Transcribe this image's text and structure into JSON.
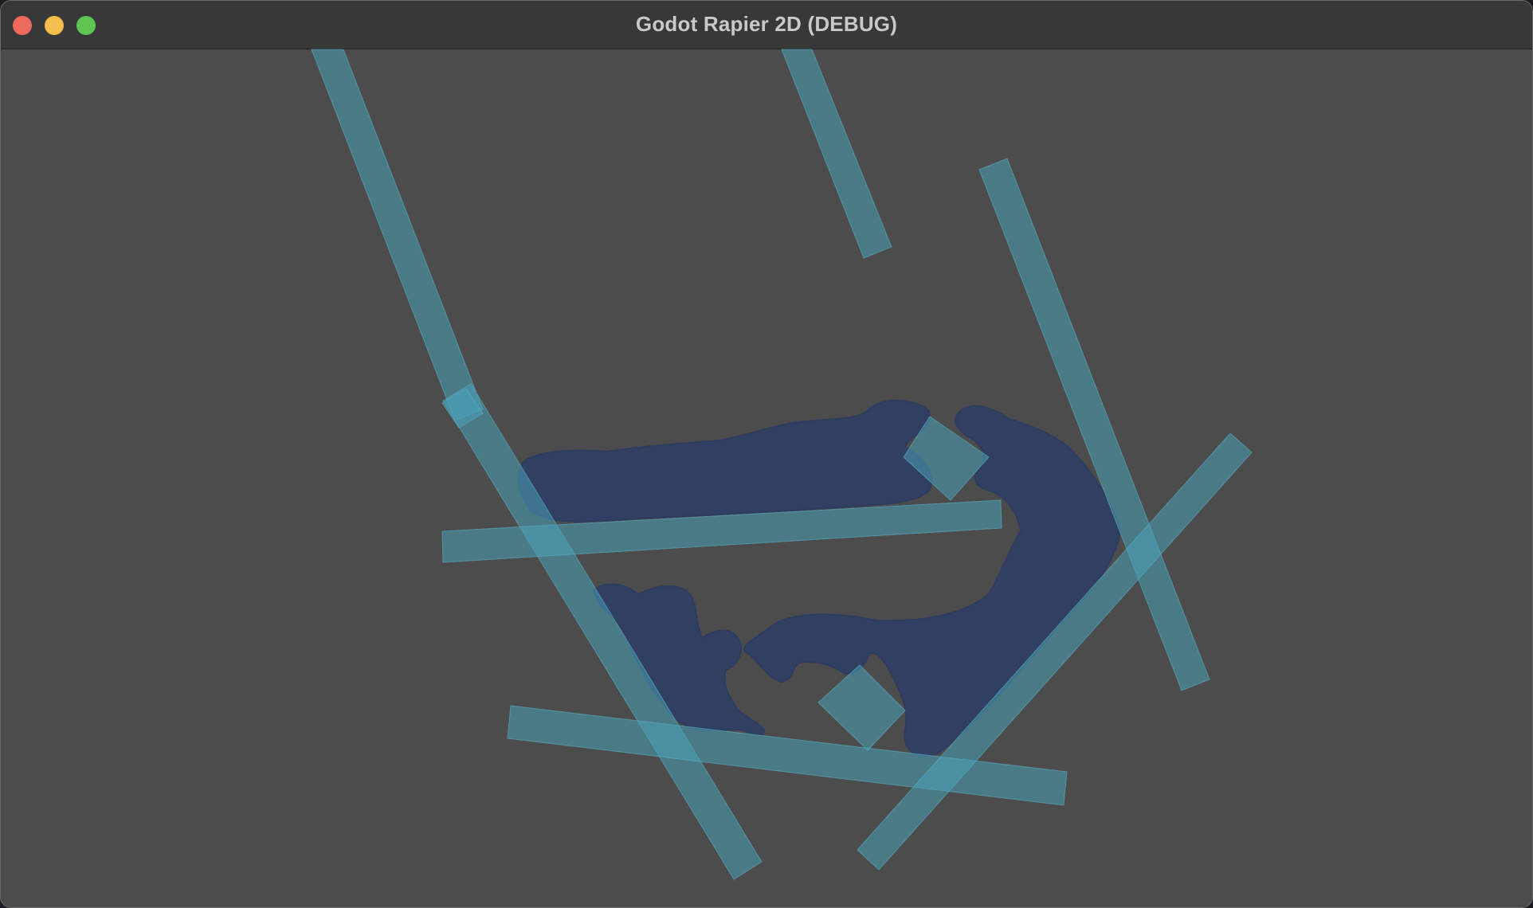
{
  "window": {
    "title": "Godot Rapier 2D (DEBUG)"
  },
  "colors": {
    "background": "#4c4c4c",
    "titlebar": "#383838",
    "fluid": "#313f63",
    "static_body": "#4aa0b8",
    "close": "#ed6a5e",
    "minimize": "#f5bf4f",
    "zoom": "#61c554"
  }
}
